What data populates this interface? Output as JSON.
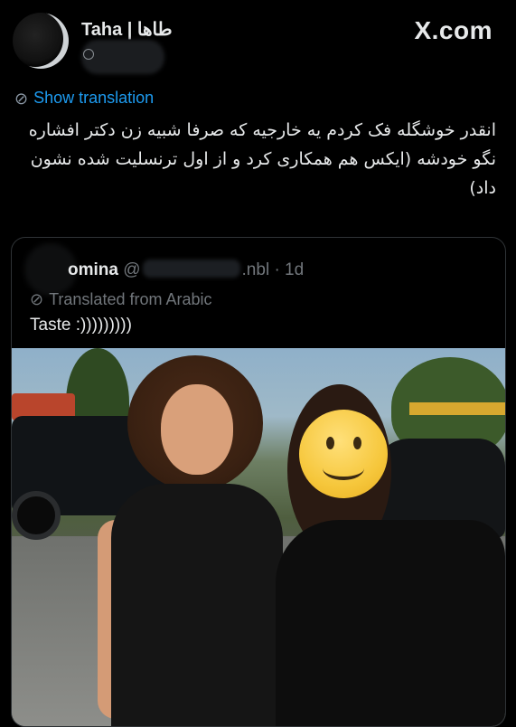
{
  "author": {
    "name": "Taha | طاها"
  },
  "brand": "X.com",
  "show_translation": {
    "label": "Show translation",
    "icon": "translate-icon"
  },
  "tweet": {
    "text": "انقدر خوشگله فک کردم یه خارجیه که صرفا شبیه زن دکتر افشاره نگو خودشه (ایکس هم همکاری کرد و از اول ترنسلیت شده نشون داد)"
  },
  "quote": {
    "name_fragment": "omina",
    "at_prefix": "@",
    "handle_suffix": ".nbl",
    "time": "· 1d",
    "translated_label": "Translated from Arabic",
    "text": "Taste :)))))))))"
  },
  "colors": {
    "accent": "#1d9bf0",
    "background": "#000000",
    "secondary_text": "#71767b"
  }
}
